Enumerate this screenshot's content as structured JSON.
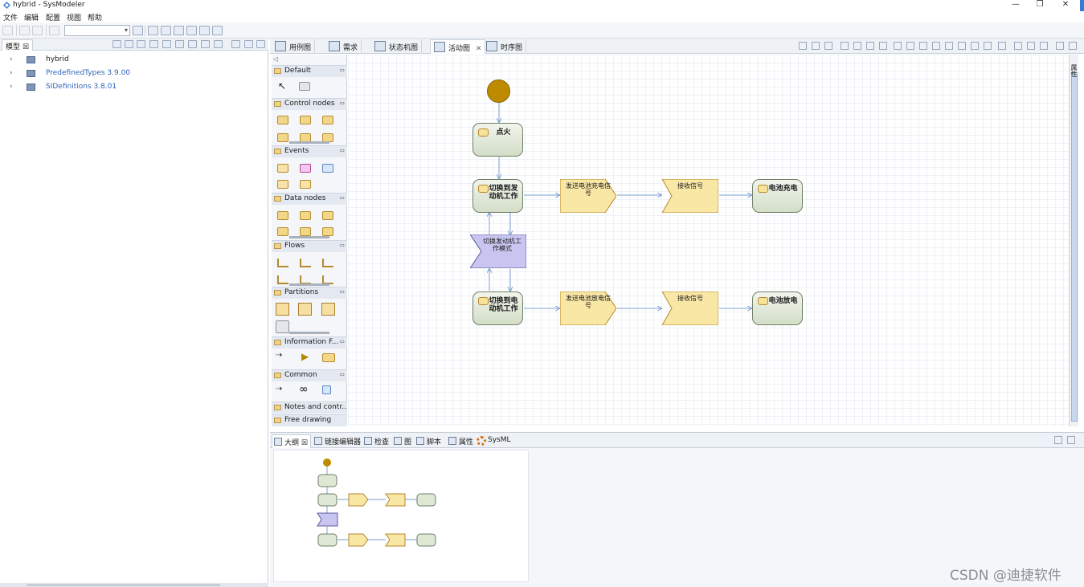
{
  "window": {
    "title": "hybrid - SysModeler",
    "controls": {
      "minimize": "—",
      "restore": "❐",
      "close": "✕"
    }
  },
  "menu": [
    "文件",
    "编辑",
    "配置",
    "视图",
    "帮助"
  ],
  "model_panel": {
    "tab_label": "模型",
    "tree": [
      {
        "label": "hybrid",
        "type": "model"
      },
      {
        "label": "PredefinedTypes 3.9.00",
        "type": "library"
      },
      {
        "label": "SIDefinitions 3.8.01",
        "type": "library"
      }
    ]
  },
  "editor_tabs": [
    {
      "label": "用例图"
    },
    {
      "label": "需求"
    },
    {
      "label": "状态机图"
    },
    {
      "label": "活动图",
      "active": true
    },
    {
      "label": "时序图"
    }
  ],
  "palette": {
    "collapse_glyph": "◁",
    "groups": [
      "Default",
      "Control nodes",
      "Events",
      "Data nodes",
      "Flows",
      "Partitions",
      "Information F...",
      "Common",
      "Notes and contr...",
      "Free drawing"
    ]
  },
  "diagram": {
    "initial_node": "initial",
    "actions": {
      "ignite": "点火",
      "switch_engine": "切换到发动机工作",
      "switch_electric": "切换到电动机工作",
      "charge": "电池充电",
      "discharge": "电池放电"
    },
    "decision_label": "切换发动机工作模式",
    "send_signals": {
      "charge": "发送电池充电信号",
      "discharge": "发送电池放电信号"
    },
    "receive_signals": {
      "charge": "接收信号",
      "discharge": "接收信号"
    }
  },
  "side_tab_label": "属性",
  "bottom_tabs": [
    {
      "label": "大纲",
      "active": true
    },
    {
      "label": "链接编辑器"
    },
    {
      "label": "检查"
    },
    {
      "label": "图"
    },
    {
      "label": "脚本"
    },
    {
      "label": "属性"
    },
    {
      "label": "SysML"
    }
  ],
  "watermark": "CSDN @迪捷软件",
  "colors": {
    "initial_fill": "#bd8a00",
    "action_fill": "#dfe8d5",
    "signal_fill": "#f9e7a6",
    "decision_fill": "#c8c6f0",
    "flow_line": "#7b9fd1"
  }
}
